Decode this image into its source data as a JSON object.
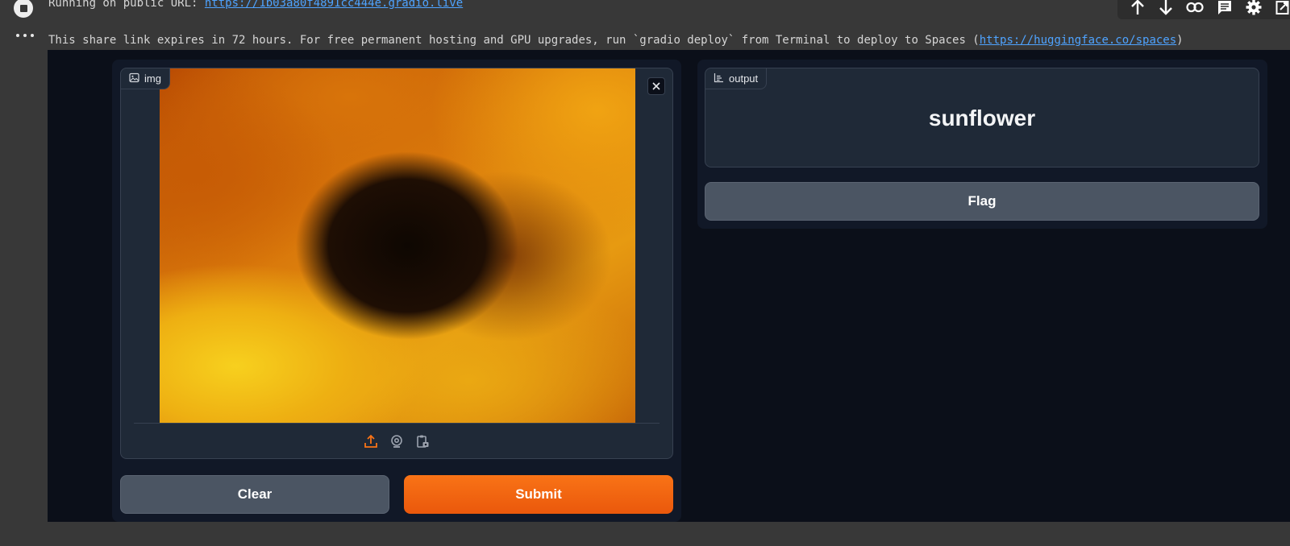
{
  "notebook": {
    "line1_prefix": "Running on public URL: ",
    "line1_link": "https://1b03a80f4891cc444e.gradio.live",
    "line2_prefix": "This share link expires in 72 hours. For free permanent hosting and GPU upgrades, run `gradio deploy` from Terminal to deploy to Spaces (",
    "line2_link": "https://huggingface.co/spaces",
    "line2_suffix": ")"
  },
  "toolbar": {
    "icons": [
      "arrow-up-icon",
      "arrow-down-icon",
      "link-icon",
      "comment-icon",
      "gear-icon",
      "open-external-icon"
    ]
  },
  "gradio": {
    "input": {
      "label": "img",
      "image_alt": "sunflower close-up",
      "source_icons": [
        "upload-icon",
        "webcam-icon",
        "clipboard-icon"
      ]
    },
    "output": {
      "label": "output",
      "value": "sunflower"
    },
    "buttons": {
      "clear": "Clear",
      "submit": "Submit",
      "flag": "Flag"
    }
  },
  "colors": {
    "accent": "#f97316",
    "link": "#4ea3ff",
    "panel_bg": "#111827",
    "page_bg": "#0b0f19"
  }
}
